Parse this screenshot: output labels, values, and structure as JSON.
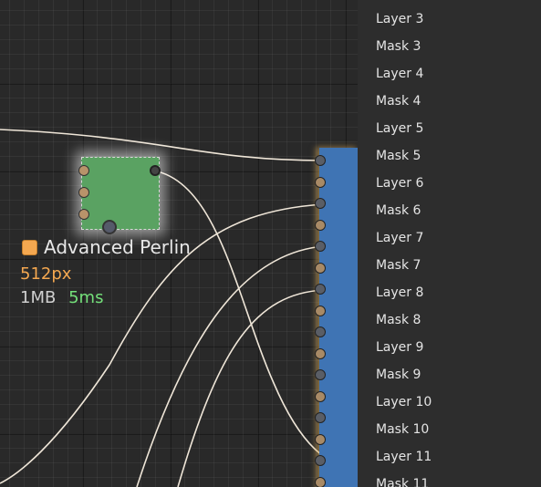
{
  "node": {
    "title": "Advanced Perlin",
    "resolution": "512px",
    "memory": "1MB",
    "time": "5ms",
    "accent": "#f5a850",
    "node_color": "#5aa262"
  },
  "output_node": {
    "color": "#3f74b4"
  },
  "layers": [
    "Layer 3",
    "Mask 3",
    "Layer 4",
    "Mask 4",
    "Layer 5",
    "Mask 5",
    "Layer 6",
    "Mask 6",
    "Layer 7",
    "Mask 7",
    "Layer 8",
    "Mask 8",
    "Layer 9",
    "Mask 9",
    "Layer 10",
    "Mask 10",
    "Layer 11",
    "Mask 11"
  ]
}
